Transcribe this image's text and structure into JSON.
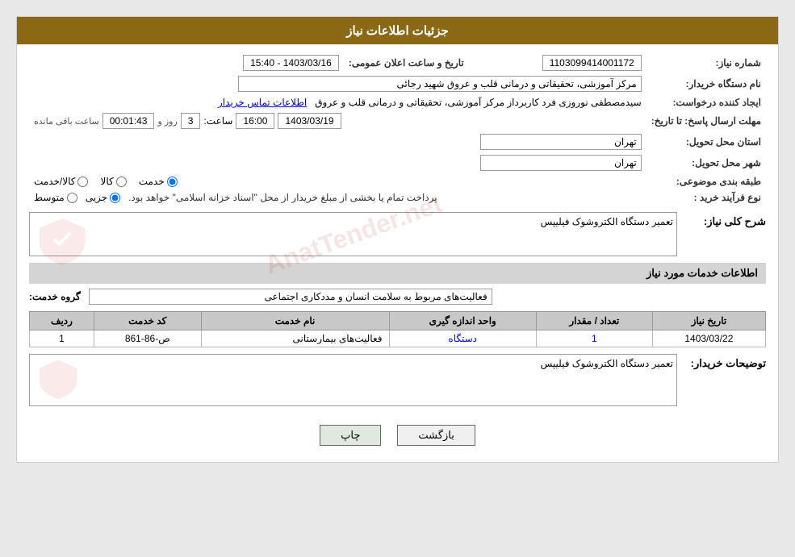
{
  "header": {
    "title": "جزئیات اطلاعات نیاز"
  },
  "fields": {
    "req_number_label": "شماره نیاز:",
    "req_number_value": "1103099414001172",
    "announce_date_label": "تاریخ و ساعت اعلان عمومی:",
    "announce_date_value": "1403/03/16 - 15:40",
    "buyer_org_label": "نام دستگاه خریدار:",
    "buyer_org_value": "مرکز آموزشی، تحقیقاتی و درمانی قلب و عروق شهید رجائی",
    "creator_label": "ایجاد کننده درخواست:",
    "creator_value": "سیدمصطفی نوروزی فرد کاربرداز مرکز آموزشی، تحقیقاتی و درمانی قلب و عروق",
    "contact_link": "اطلاعات تماس خریدار",
    "response_deadline_label": "مهلت ارسال پاسخ: تا تاریخ:",
    "response_date": "1403/03/19",
    "response_time": "16:00",
    "response_days": "3",
    "response_remaining": "00:01:43",
    "response_days_label": "روز و",
    "response_hours_label": "ساعت باقی مانده",
    "province_label": "استان محل تحویل:",
    "province_value": "تهران",
    "city_label": "شهر محل تحویل:",
    "city_value": "تهران",
    "category_label": "طبقه بندی موضوعی:",
    "radio_service": "خدمت",
    "radio_goods": "کالا",
    "radio_goods_service": "کالا/خدمت",
    "purchase_type_label": "نوع فرآیند خرید :",
    "radio_partial": "جزیی",
    "radio_medium": "متوسط",
    "purchase_note": "پرداخت تمام یا بخشی از مبلغ خریدار از محل \"اسناد خزانه اسلامی\" خواهد بود.",
    "general_desc_label": "شرح کلی نیاز:",
    "general_desc_value": "تعمیر دستگاه الکتروشوک فیلیپس",
    "services_header": "اطلاعات خدمات مورد نیاز",
    "service_group_label": "گروه خدمت:",
    "service_group_value": "فعالیت‌های مربوط به سلامت انسان و مددکاری اجتماعی",
    "table_headers": [
      "ردیف",
      "کد خدمت",
      "نام خدمت",
      "واحد اندازه گیری",
      "تعداد / مقدار",
      "تاریخ نیاز"
    ],
    "table_rows": [
      {
        "row": "1",
        "code": "ص-86-861",
        "name": "فعالیت‌های بیمارستانی",
        "unit": "دستگاه",
        "qty": "1",
        "date": "1403/03/22"
      }
    ],
    "buyer_desc_label": "توضیحات خریدار:",
    "buyer_desc_value": "تعمیر دستگاه الکتروشوک فیلیپس"
  },
  "buttons": {
    "print_label": "چاپ",
    "back_label": "بازگشت"
  }
}
